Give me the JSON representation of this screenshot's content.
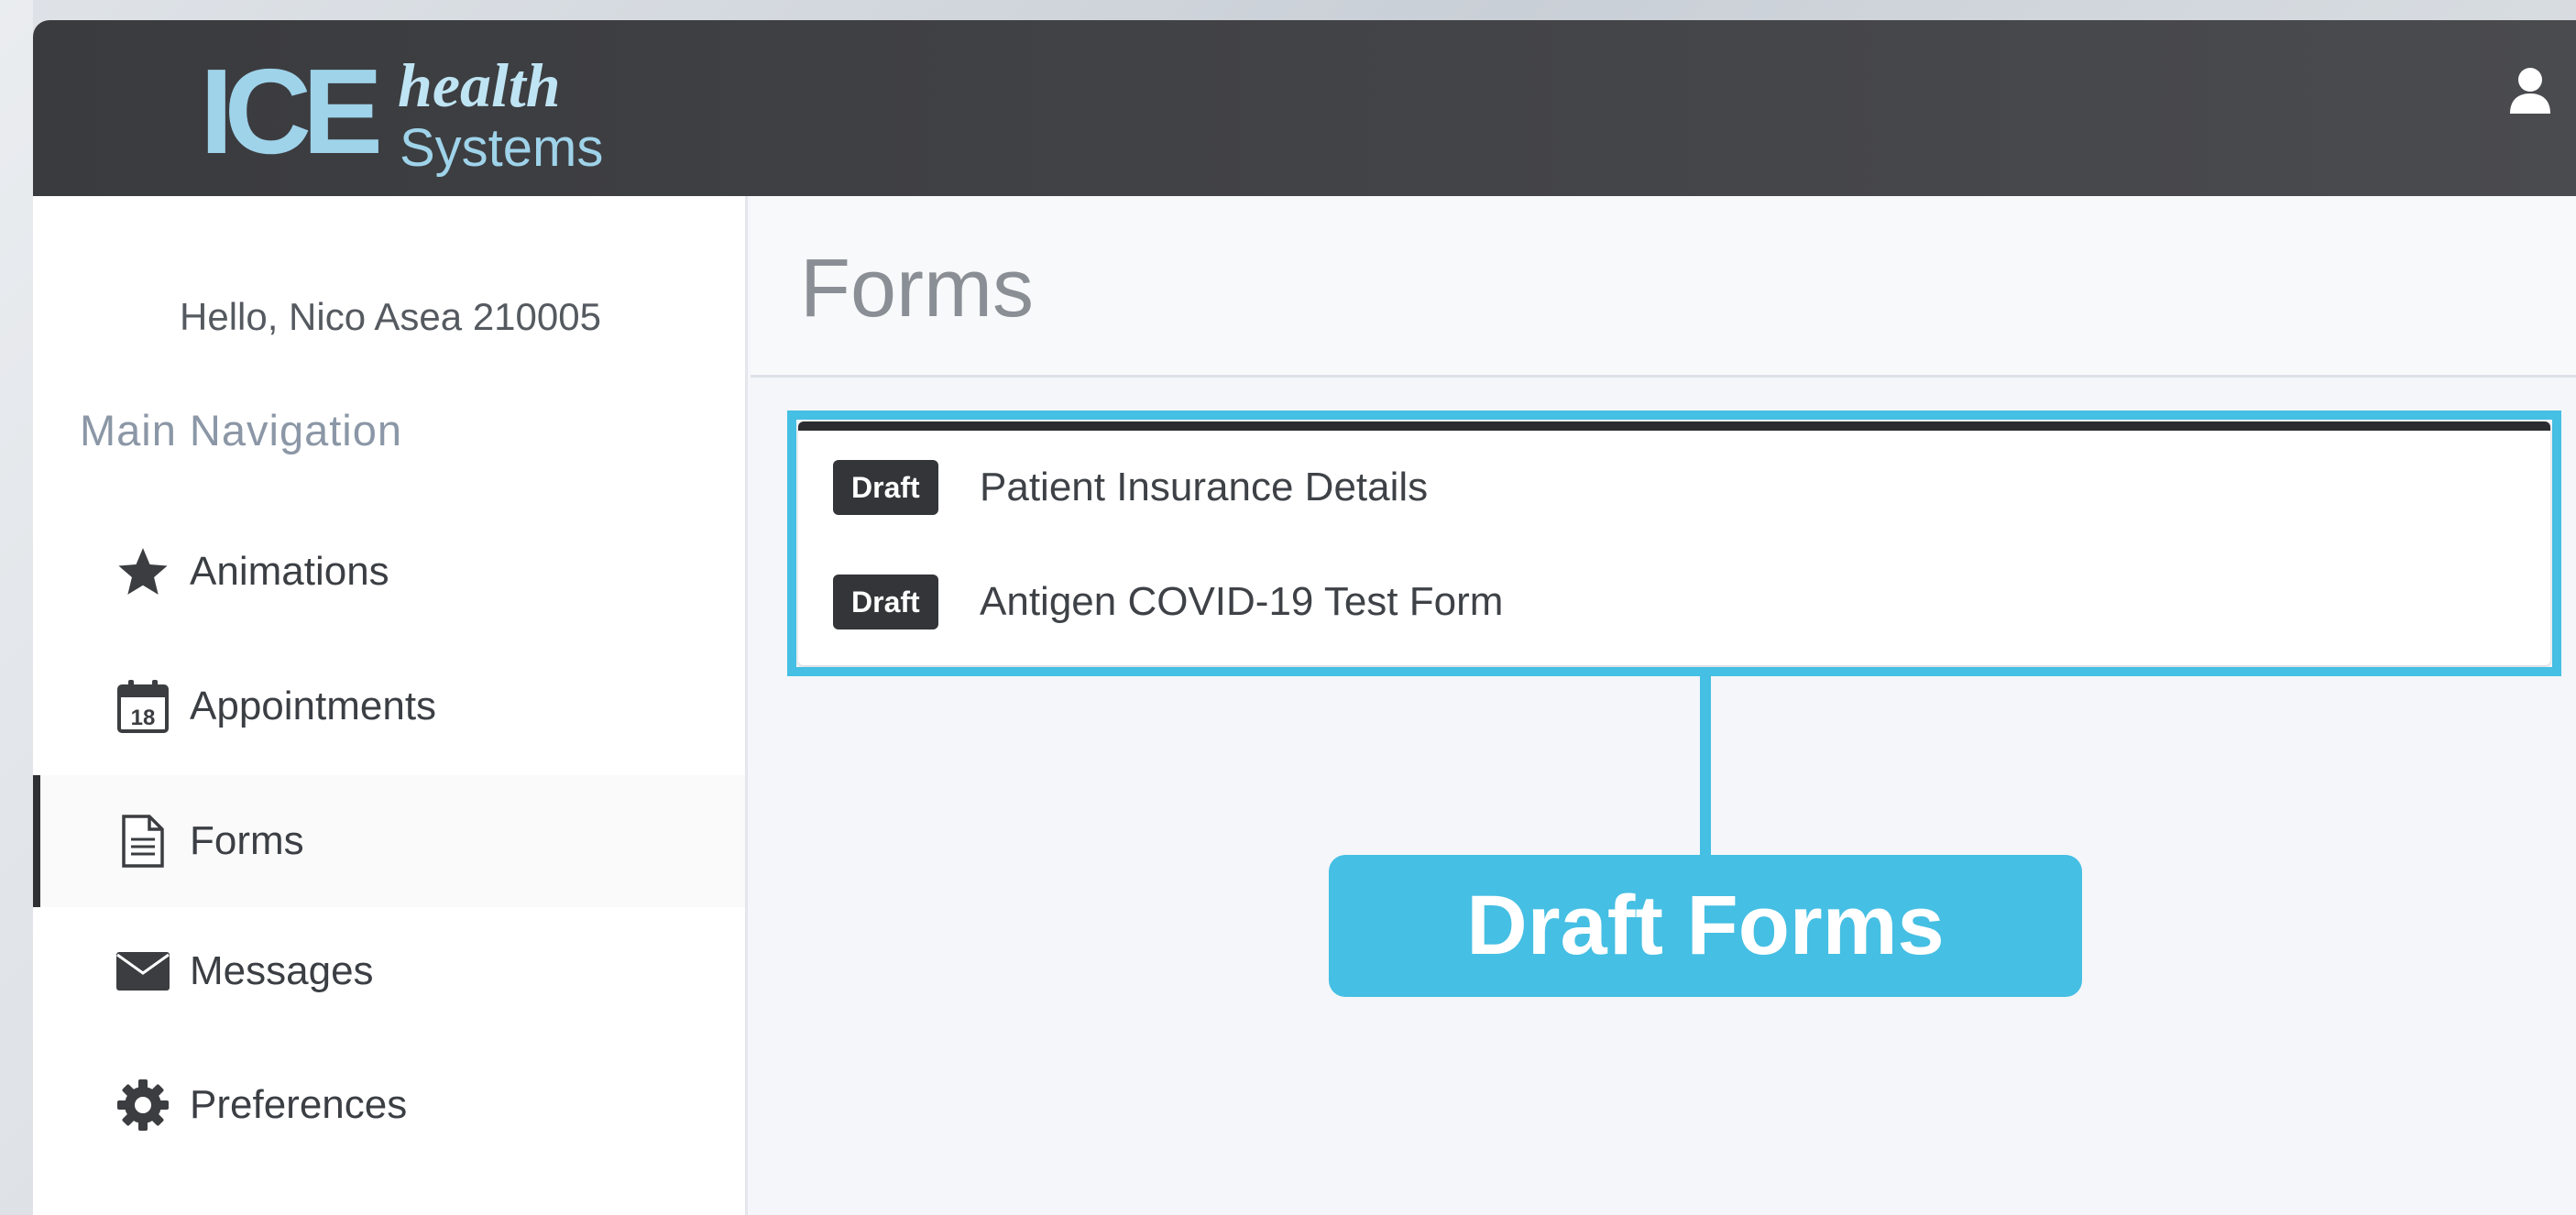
{
  "app": {
    "logo": {
      "ice": "ICE",
      "health": "health",
      "systems": "Systems"
    }
  },
  "sidebar": {
    "greeting": "Hello, Nico Asea 210005",
    "nav_heading": "Main Navigation",
    "items": [
      {
        "label": "Animations",
        "icon": "star-icon"
      },
      {
        "label": "Appointments",
        "icon": "calendar-icon",
        "calendar_day": "18"
      },
      {
        "label": "Forms",
        "icon": "document-icon",
        "active": true
      },
      {
        "label": "Messages",
        "icon": "envelope-icon"
      },
      {
        "label": "Preferences",
        "icon": "gear-icon"
      }
    ]
  },
  "main": {
    "title": "Forms",
    "forms": [
      {
        "status": "Draft",
        "name": "Patient Insurance Details"
      },
      {
        "status": "Draft",
        "name": "Antigen COVID-19 Test Form"
      }
    ]
  },
  "annotation": {
    "callout_label": "Draft Forms",
    "color": "#45bfe3"
  }
}
